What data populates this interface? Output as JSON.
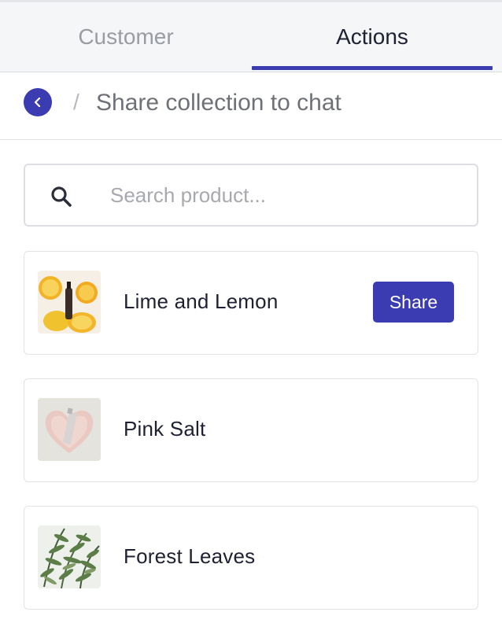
{
  "tabs": [
    {
      "label": "Customer",
      "active": false
    },
    {
      "label": "Actions",
      "active": true
    }
  ],
  "header": {
    "separator": "/",
    "title": "Share collection to chat",
    "back_icon": "chevron-left-icon"
  },
  "search": {
    "placeholder": "Search product...",
    "value": "",
    "icon": "search-icon"
  },
  "products": [
    {
      "name": "Lime and Lemon",
      "share_label": "Share",
      "share_visible": true
    },
    {
      "name": "Pink Salt",
      "share_visible": false
    },
    {
      "name": "Forest Leaves",
      "share_visible": false
    }
  ],
  "colors": {
    "accent": "#3b3bb2",
    "tab_bg": "#f5f6f8",
    "muted_text": "#9a9ca3",
    "text": "#1f2133"
  }
}
